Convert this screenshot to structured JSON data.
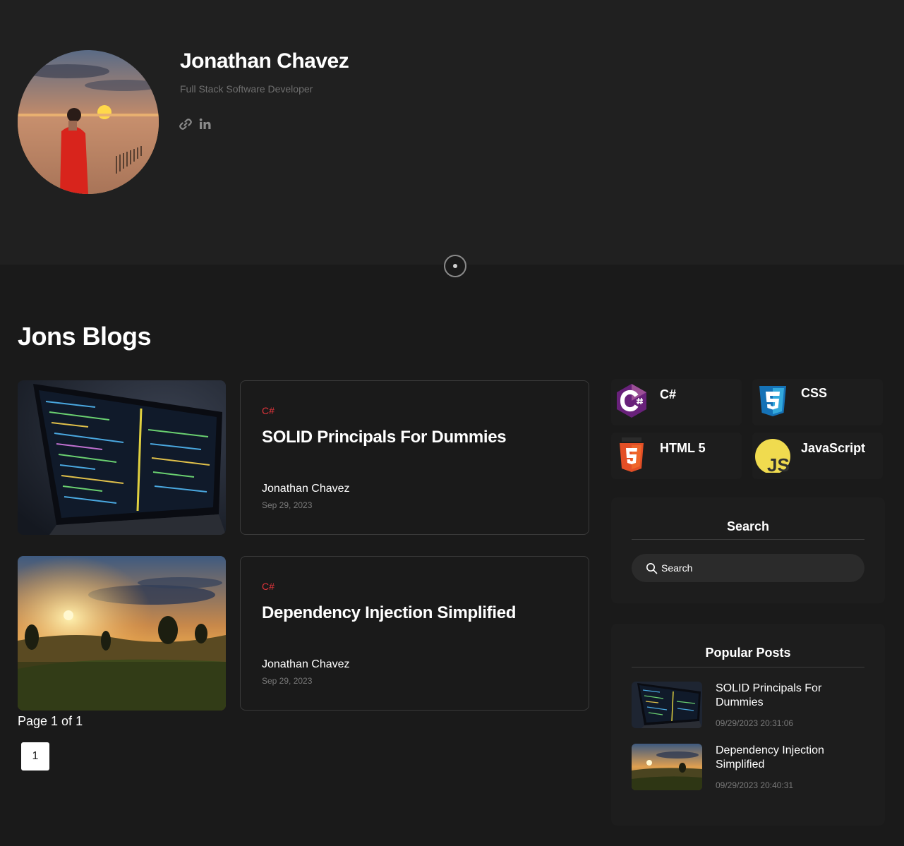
{
  "profile": {
    "name": "Jonathan Chavez",
    "subtitle": "Full Stack Software Developer",
    "social": [
      "link-icon",
      "linkedin-icon"
    ]
  },
  "blogs": {
    "heading": "Jons Blogs",
    "posts": [
      {
        "category": "C#",
        "title": "SOLID Principals For Dummies",
        "author": "Jonathan Chavez",
        "date": "Sep 29, 2023",
        "image": "laptop-code-image"
      },
      {
        "category": "C#",
        "title": "Dependency Injection Simplified",
        "author": "Jonathan Chavez",
        "date": "Sep 29, 2023",
        "image": "sunrise-landscape-image"
      }
    ],
    "pagination": {
      "info": "Page 1 of 1",
      "pages": [
        "1"
      ]
    }
  },
  "sidebar": {
    "tags": [
      {
        "label": "C#",
        "icon": "csharp-icon"
      },
      {
        "label": "CSS",
        "icon": "css3-icon"
      },
      {
        "label": "HTML 5",
        "icon": "html5-icon"
      },
      {
        "label": "JavaScript",
        "icon": "javascript-icon"
      }
    ],
    "search": {
      "title": "Search",
      "placeholder": "Search"
    },
    "popular": {
      "title": "Popular Posts",
      "items": [
        {
          "title": "SOLID Principals For Dummies",
          "date": "09/29/2023 20:31:06"
        },
        {
          "title": "Dependency Injection Simplified",
          "date": "09/29/2023 20:40:31"
        }
      ]
    }
  },
  "colors": {
    "background": "#1a1a1a",
    "header": "#202020",
    "category": "#e0343b",
    "muted": "#7a7a7a"
  }
}
